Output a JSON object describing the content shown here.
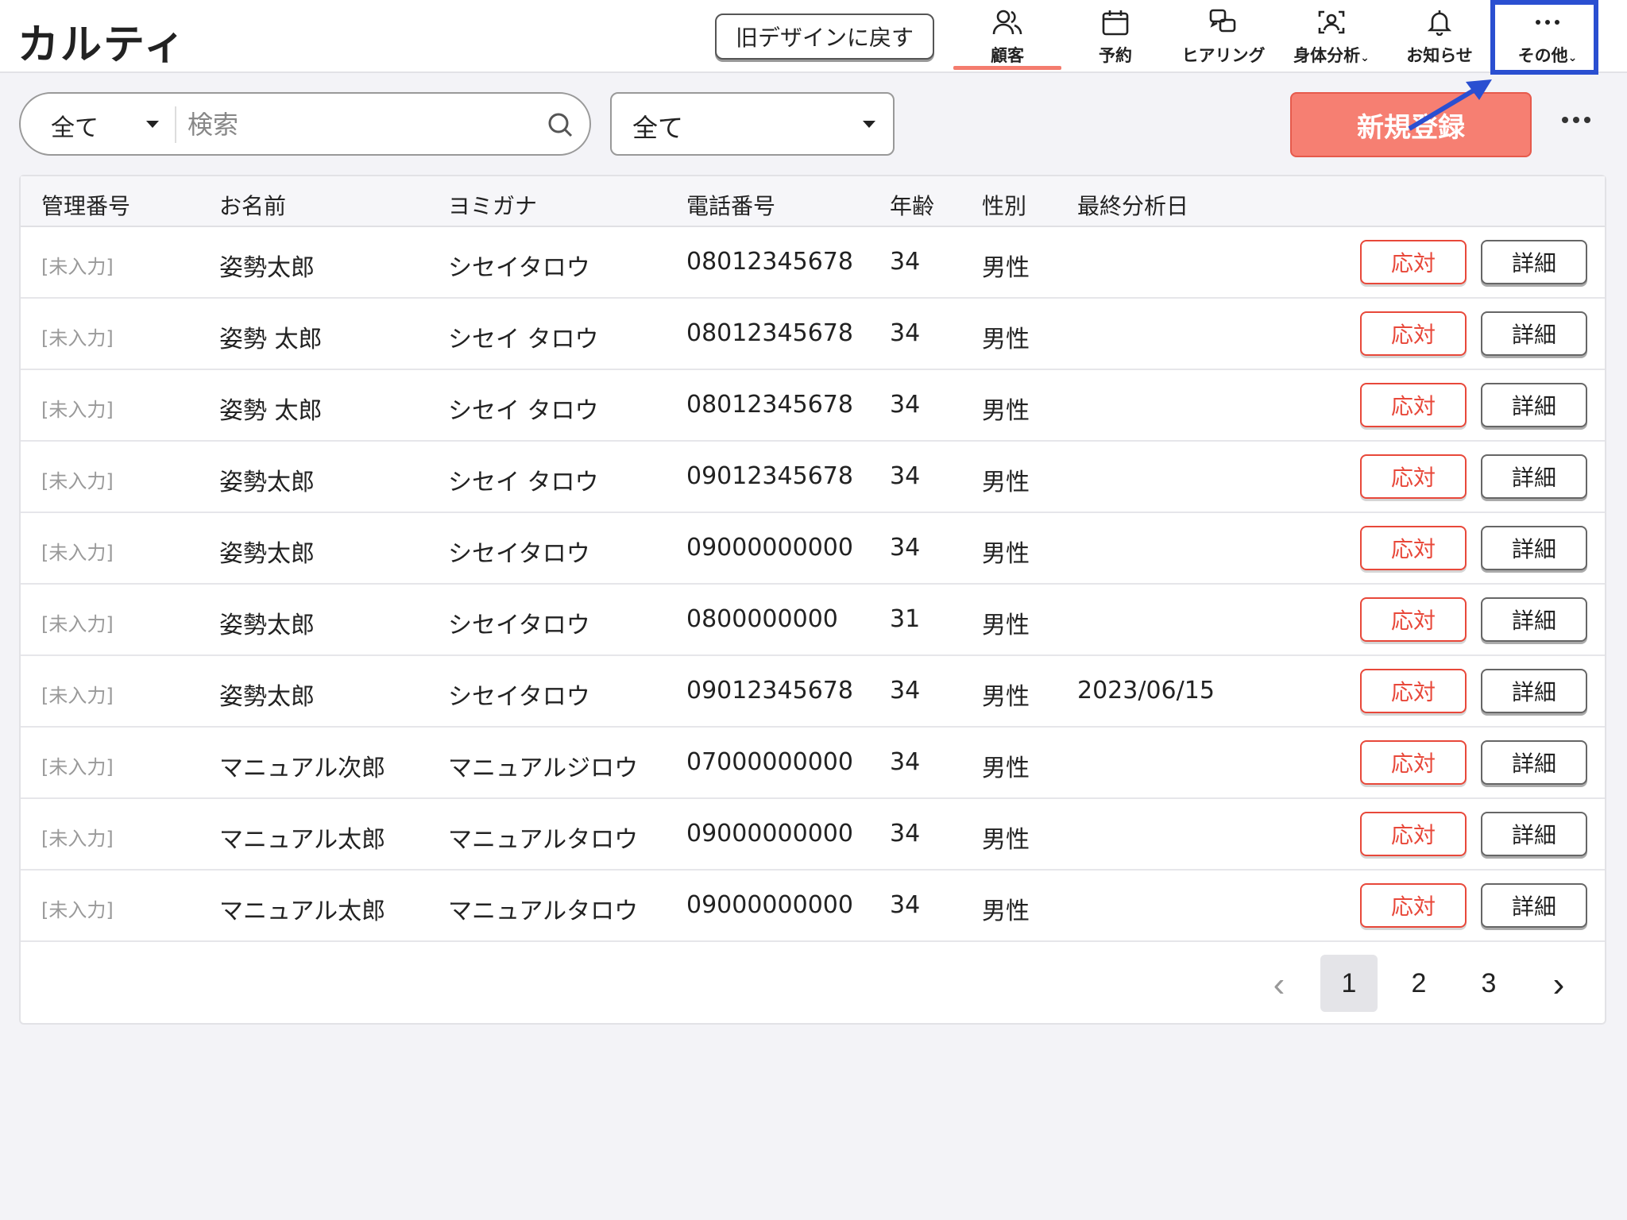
{
  "app": {
    "logo": "カルティ"
  },
  "header": {
    "old_design_label": "旧デザインに戻す",
    "nav": [
      {
        "label": "顧客",
        "icon": "users-icon",
        "active": true
      },
      {
        "label": "予約",
        "icon": "calendar-icon"
      },
      {
        "label": "ヒアリング",
        "icon": "chat-icon"
      },
      {
        "label": "身体分析",
        "icon": "person-scan-icon",
        "dropdown": true
      },
      {
        "label": "お知らせ",
        "icon": "bell-icon"
      },
      {
        "label": "その他",
        "icon": "more-dots-icon",
        "dropdown": true
      }
    ]
  },
  "toolbar": {
    "search_scope": "全て",
    "search_placeholder": "検索",
    "filter_value": "全て",
    "new_button": "新規登録"
  },
  "table": {
    "headers": [
      "管理番号",
      "お名前",
      "ヨミガナ",
      "電話番号",
      "年齢",
      "性別",
      "最終分析日"
    ],
    "respond_label": "応対",
    "detail_label": "詳細",
    "rows": [
      {
        "id": "[未入力]",
        "name": "姿勢太郎",
        "kana": "シセイタロウ",
        "phone": "08012345678",
        "age": "34",
        "gender": "男性",
        "last": ""
      },
      {
        "id": "[未入力]",
        "name": "姿勢 太郎",
        "kana": "シセイ タロウ",
        "phone": "08012345678",
        "age": "34",
        "gender": "男性",
        "last": ""
      },
      {
        "id": "[未入力]",
        "name": "姿勢 太郎",
        "kana": "シセイ タロウ",
        "phone": "08012345678",
        "age": "34",
        "gender": "男性",
        "last": ""
      },
      {
        "id": "[未入力]",
        "name": "姿勢太郎",
        "kana": "シセイ タロウ",
        "phone": "09012345678",
        "age": "34",
        "gender": "男性",
        "last": ""
      },
      {
        "id": "[未入力]",
        "name": "姿勢太郎",
        "kana": "シセイタロウ",
        "phone": "09000000000",
        "age": "34",
        "gender": "男性",
        "last": ""
      },
      {
        "id": "[未入力]",
        "name": "姿勢太郎",
        "kana": "シセイタロウ",
        "phone": "0800000000",
        "age": "31",
        "gender": "男性",
        "last": ""
      },
      {
        "id": "[未入力]",
        "name": "姿勢太郎",
        "kana": "シセイタロウ",
        "phone": "09012345678",
        "age": "34",
        "gender": "男性",
        "last": "2023/06/15"
      },
      {
        "id": "[未入力]",
        "name": "マニュアル次郎",
        "kana": "マニュアルジロウ",
        "phone": "07000000000",
        "age": "34",
        "gender": "男性",
        "last": ""
      },
      {
        "id": "[未入力]",
        "name": "マニュアル太郎",
        "kana": "マニュアルタロウ",
        "phone": "09000000000",
        "age": "34",
        "gender": "男性",
        "last": ""
      },
      {
        "id": "[未入力]",
        "name": "マニュアル太郎",
        "kana": "マニュアルタロウ",
        "phone": "09000000000",
        "age": "34",
        "gender": "男性",
        "last": ""
      }
    ]
  },
  "pagination": {
    "prev": "‹",
    "next": "›",
    "pages": [
      "1",
      "2",
      "3"
    ],
    "current": "1"
  },
  "colors": {
    "accent": "#f67f72",
    "respond": "#e8483a",
    "highlight": "#2a4fd1"
  }
}
